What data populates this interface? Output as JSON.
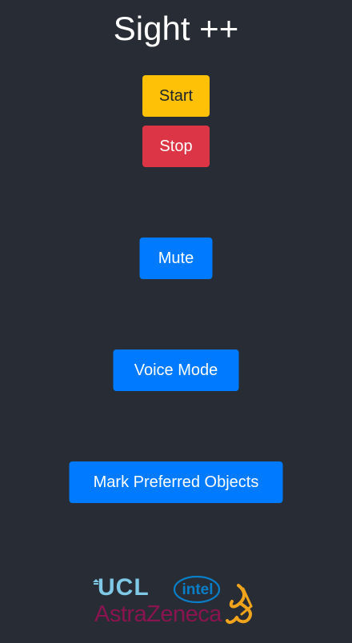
{
  "app": {
    "title": "Sight ++"
  },
  "controls": {
    "start_label": "Start",
    "stop_label": "Stop",
    "mute_label": "Mute",
    "voice_mode_label": "Voice Mode",
    "mark_preferred_label": "Mark Preferred Objects"
  },
  "footer": {
    "ucl_logo_text": "UCL",
    "intel_logo_text": "intel",
    "astrazeneca_logo_text": "AstraZeneca"
  },
  "colors": {
    "background": "#282c34",
    "start": "#ffc107",
    "stop": "#dc3545",
    "primary": "#007bff"
  }
}
